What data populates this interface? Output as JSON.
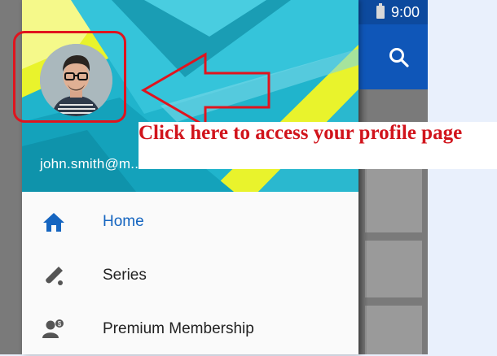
{
  "statusbar": {
    "time": "9:00",
    "battery_icon": "battery-icon"
  },
  "toolbar": {
    "search_icon": "search-icon"
  },
  "drawer": {
    "account_email": "john.smith@m...com",
    "nav_items": [
      {
        "label": "Home",
        "icon": "home-icon",
        "active": true
      },
      {
        "label": "Series",
        "icon": "cricket-bat-icon",
        "active": false
      },
      {
        "label": "Premium Membership",
        "icon": "premium-membership-icon",
        "active": false
      }
    ]
  },
  "annotation": {
    "callout_text": "Click here to access your profile page"
  },
  "colors": {
    "accent": "#1565c0",
    "annotation_red": "#e0141e",
    "header_teal": "#1fb6cf",
    "header_yellow": "#e8f02a",
    "toolbar_blue": "#0f56b8"
  }
}
